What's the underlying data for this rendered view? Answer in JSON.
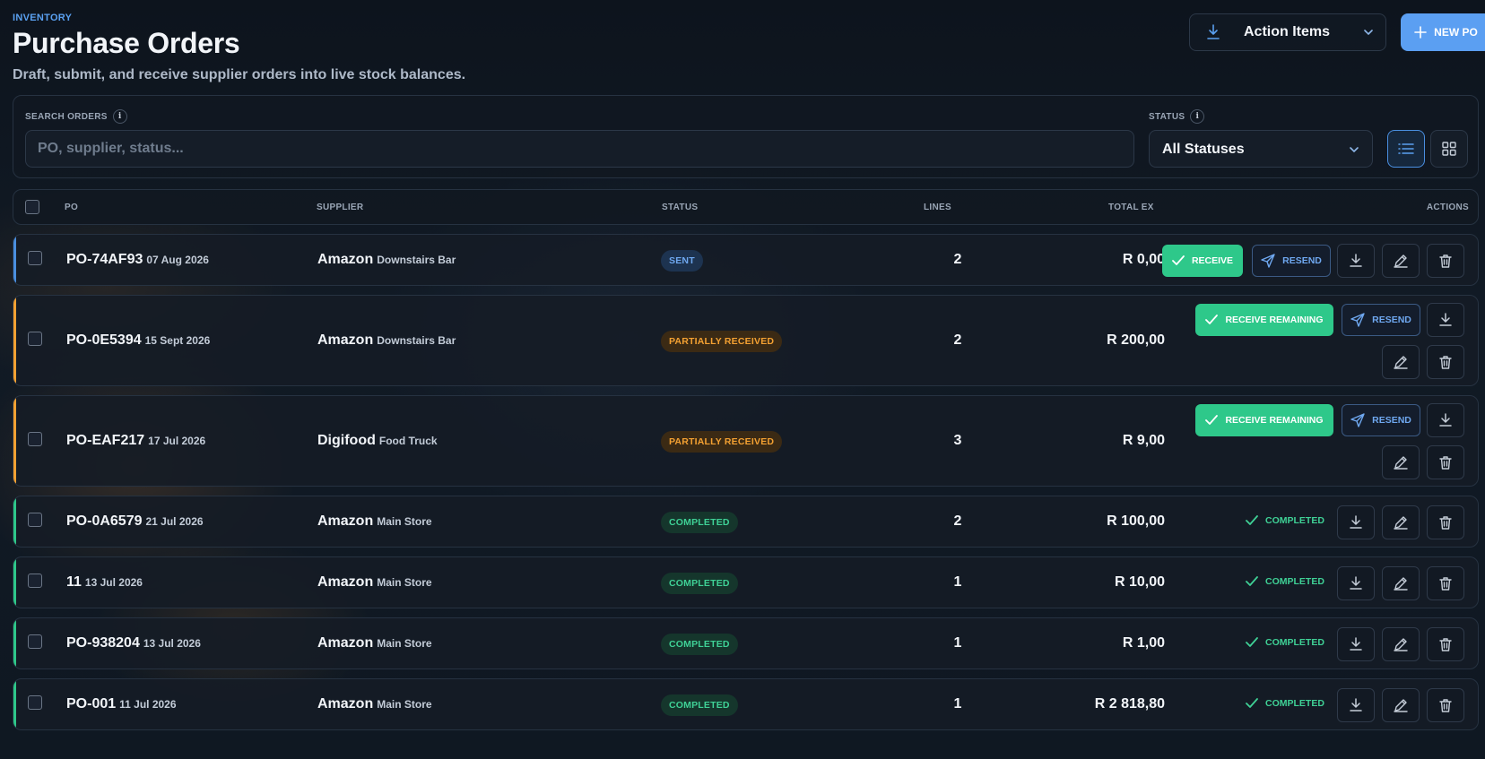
{
  "header": {
    "eyebrow": "INVENTORY",
    "title": "Purchase Orders",
    "subtitle": "Draft, submit, and receive supplier orders into live stock balances.",
    "action_items_label": "Action Items",
    "new_po_label": "NEW PO"
  },
  "filters": {
    "search_label": "SEARCH ORDERS",
    "search_placeholder": "PO, supplier, status...",
    "search_value": "",
    "status_label": "STATUS",
    "status_value": "All Statuses",
    "info_glyph": "i",
    "view_mode": "list"
  },
  "table": {
    "headers": {
      "po": "PO",
      "supplier": "SUPPLIER",
      "status": "STATUS",
      "lines": "LINES",
      "total": "TOTAL EX",
      "actions": "ACTIONS"
    },
    "rows": [
      {
        "po": "PO-74AF93",
        "date": "07 Aug 2026",
        "supplier": "Amazon",
        "location": "Downstairs Bar",
        "status": "SENT",
        "lines": "2",
        "total": "R 0,00",
        "receive_label": "RECEIVE",
        "resend_label": "RESEND"
      },
      {
        "po": "PO-0E5394",
        "date": "15 Sept 2026",
        "supplier": "Amazon",
        "location": "Downstairs Bar",
        "status": "PARTIALLY RECEIVED",
        "lines": "2",
        "total": "R 200,00",
        "receive_label": "RECEIVE REMAINING",
        "resend_label": "RESEND"
      },
      {
        "po": "PO-EAF217",
        "date": "17 Jul 2026",
        "supplier": "Digifood",
        "location": "Food Truck",
        "status": "PARTIALLY RECEIVED",
        "lines": "3",
        "total": "R 9,00",
        "receive_label": "RECEIVE REMAINING",
        "resend_label": "RESEND"
      },
      {
        "po": "PO-0A6579",
        "date": "21 Jul 2026",
        "supplier": "Amazon",
        "location": "Main Store",
        "status": "COMPLETED",
        "lines": "2",
        "total": "R 100,00",
        "done_label": "COMPLETED"
      },
      {
        "po": "11",
        "date": "13 Jul 2026",
        "supplier": "Amazon",
        "location": "Main Store",
        "status": "COMPLETED",
        "lines": "1",
        "total": "R 10,00",
        "done_label": "COMPLETED"
      },
      {
        "po": "PO-938204",
        "date": "13 Jul 2026",
        "supplier": "Amazon",
        "location": "Main Store",
        "status": "COMPLETED",
        "lines": "1",
        "total": "R 1,00",
        "done_label": "COMPLETED"
      },
      {
        "po": "PO-001",
        "date": "11 Jul 2026",
        "supplier": "Amazon",
        "location": "Main Store",
        "status": "COMPLETED",
        "lines": "1",
        "total": "R 2 818,80",
        "done_label": "COMPLETED"
      }
    ]
  },
  "colors": {
    "accent": "#5b9ff2",
    "sent": "#4a8fe0",
    "partial": "#f4a132",
    "completed": "#2ec88a"
  },
  "icons": {
    "action_items": "download-icon",
    "new_po": "plus-icon",
    "receive": "check-icon",
    "resend": "send-icon",
    "download": "download-icon",
    "edit": "pencil-icon",
    "delete": "trash-icon",
    "view_list": "list-icon",
    "view_grid": "grid-icon"
  }
}
